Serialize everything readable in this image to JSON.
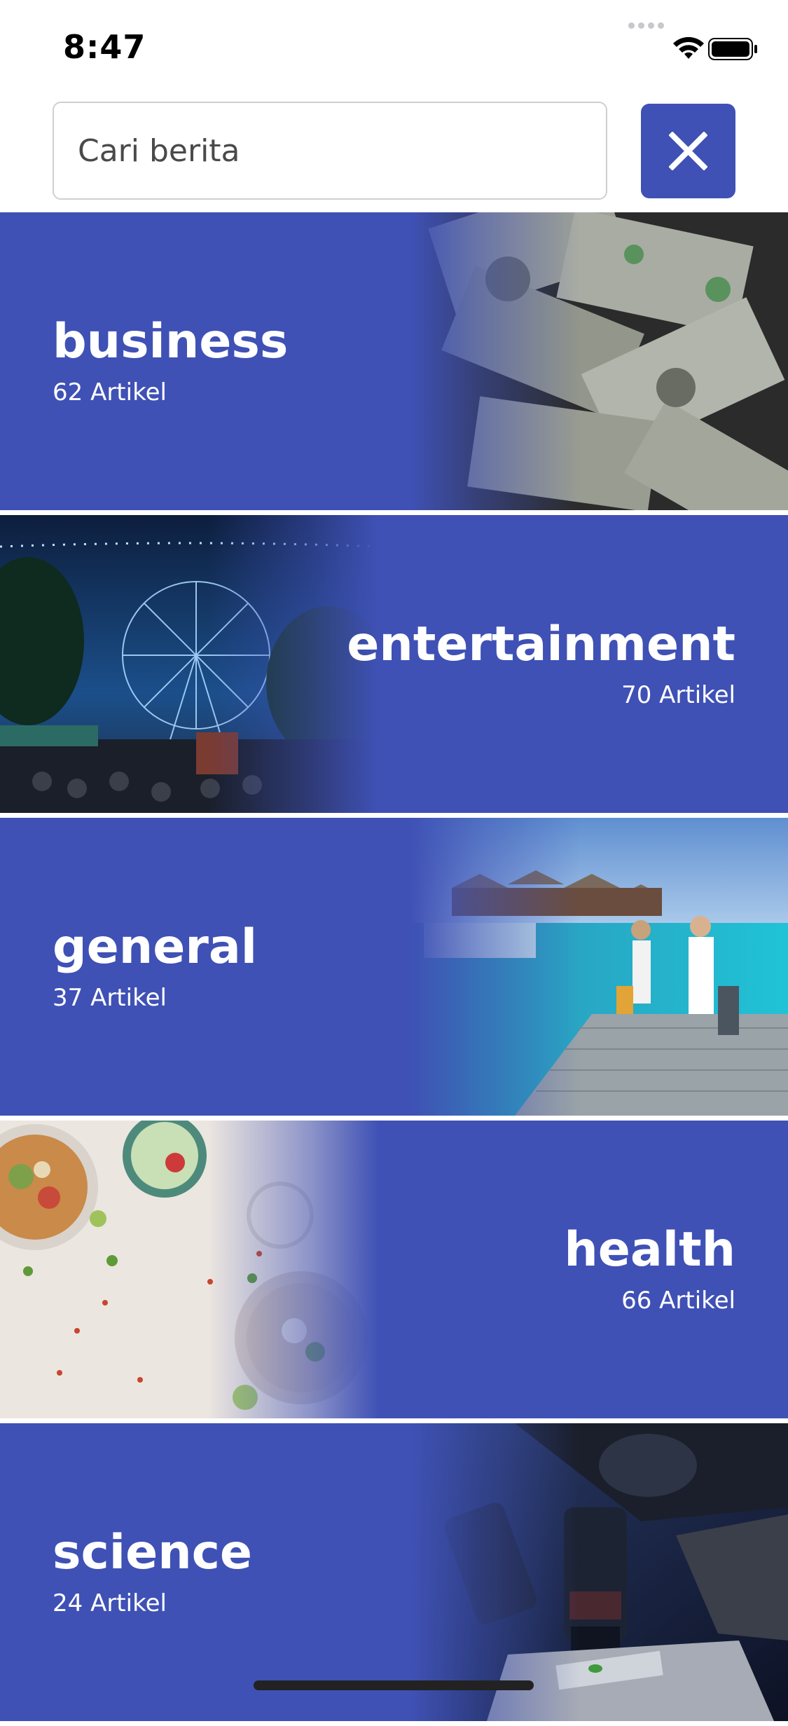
{
  "status": {
    "time": "8:47"
  },
  "search": {
    "placeholder": "Cari berita"
  },
  "colors": {
    "accent": "#3f51b5",
    "text_on_accent": "#ffffff"
  },
  "categories": [
    {
      "name": "business",
      "count": "62 Artikel",
      "image": "money-image"
    },
    {
      "name": "entertainment",
      "count": "70 Artikel",
      "image": "ferris-wheel-image"
    },
    {
      "name": "general",
      "count": "37 Artikel",
      "image": "resort-travel-image"
    },
    {
      "name": "health",
      "count": "66 Artikel",
      "image": "food-bowls-image"
    },
    {
      "name": "science",
      "count": "24 Artikel",
      "image": "microscope-image"
    }
  ]
}
